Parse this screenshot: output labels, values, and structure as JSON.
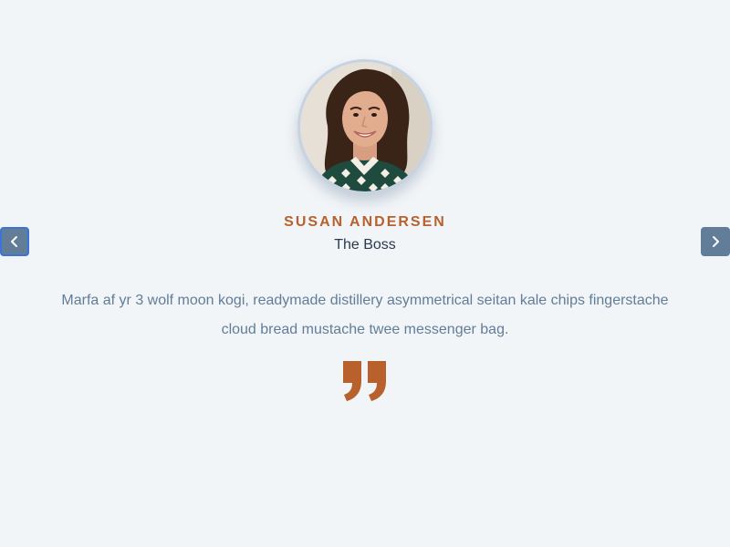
{
  "review": {
    "name": "Susan Andersen",
    "role": "The Boss",
    "text": "Marfa af yr 3 wolf moon kogi, readymade distillery asymmetrical seitan kale chips fingerstache cloud bread mustache twee messenger bag."
  },
  "icons": {
    "prev": "chevron-left-icon",
    "next": "chevron-right-icon",
    "quote": "quote-right-icon"
  },
  "colors": {
    "background": "#f1f5f8",
    "accent": "#b8612c",
    "button": "#617d98",
    "text": "#617d98",
    "heading": "#2b3a4f"
  }
}
